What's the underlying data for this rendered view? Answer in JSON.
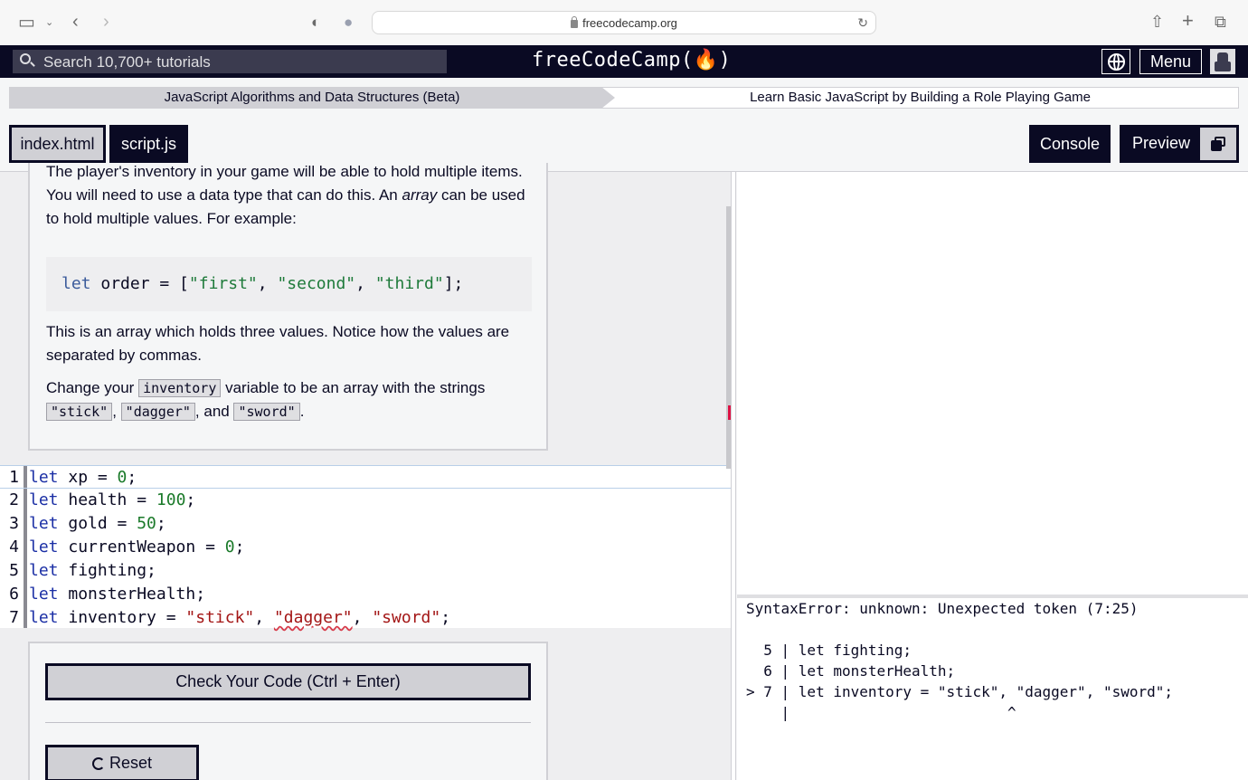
{
  "browser": {
    "url": "freecodecamp.org"
  },
  "nav": {
    "search_placeholder": "Search 10,700+ tutorials",
    "logo": "freeCodeCamp(🔥)",
    "menu_label": "Menu"
  },
  "breadcrumb": {
    "superblock": "JavaScript Algorithms and Data Structures (Beta)",
    "block": "Learn Basic JavaScript by Building a Role Playing Game"
  },
  "tabs": [
    {
      "label": "index.html",
      "selected": true
    },
    {
      "label": "script.js",
      "selected": false
    }
  ],
  "toolbar": {
    "console_label": "Console",
    "preview_label": "Preview"
  },
  "instructions": {
    "p1_a": "The player's inventory in your game will be able to hold multiple items. You will need to use a data type that can do this. An ",
    "p1_em": "array",
    "p1_b": " can be used to hold multiple values. For example:",
    "example_code": {
      "kw": "let",
      "mid": " order = [",
      "s1": "\"first\"",
      "c1": ", ",
      "s2": "\"second\"",
      "c2": ", ",
      "s3": "\"third\"",
      "end": "];"
    },
    "p2": "This is an array which holds three values. Notice how the values are separated by commas.",
    "p3_a": "Change your ",
    "p3_code": "inventory",
    "p3_b": " variable to be an array with the strings ",
    "s_stick": "\"stick\"",
    "comma": ", ",
    "s_dagger": "\"dagger\"",
    "and": ", and ",
    "s_sword": "\"sword\"",
    "period": "."
  },
  "editor": {
    "lines": [
      {
        "n": "1",
        "kw": "let",
        "rest": " xp = ",
        "val": "0",
        "end": ";"
      },
      {
        "n": "2",
        "kw": "let",
        "rest": " health = ",
        "val": "100",
        "end": ";"
      },
      {
        "n": "3",
        "kw": "let",
        "rest": " gold = ",
        "val": "50",
        "end": ";"
      },
      {
        "n": "4",
        "kw": "let",
        "rest": " currentWeapon = ",
        "val": "0",
        "end": ";"
      },
      {
        "n": "5",
        "kw": "let",
        "rest": " fighting;"
      },
      {
        "n": "6",
        "kw": "let",
        "rest": " monsterHealth;"
      },
      {
        "n": "7",
        "kw": "let",
        "rest": " inventory = ",
        "s1": "\"stick\"",
        "c1": ", ",
        "s2": "\"dagger\"",
        "c2": ", ",
        "s3": "\"sword\"",
        "end": ";"
      }
    ]
  },
  "actions": {
    "check_label": "Check Your Code (Ctrl + Enter)",
    "reset_label": "Reset"
  },
  "console": {
    "lines": [
      "SyntaxError: unknown: Unexpected token (7:25)",
      "",
      "  5 | let fighting;",
      "  6 | let monsterHealth;",
      "> 7 | let inventory = \"stick\", \"dagger\", \"sword\";",
      "    |                         ^"
    ]
  }
}
